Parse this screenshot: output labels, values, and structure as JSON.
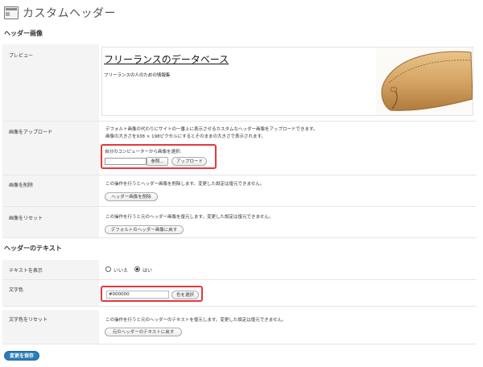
{
  "page": {
    "title": "カスタムヘッダー"
  },
  "sections": {
    "header_image": "ヘッダー画像",
    "header_text": "ヘッダーのテキスト"
  },
  "preview": {
    "label": "プレビュー",
    "site_title": "フリーランスのデータベース",
    "site_tagline": "フリーランスの人のための情報集"
  },
  "upload": {
    "label": "画像をアップロード",
    "desc_line1": "デフォルト画像の代わりにサイトの一番上に表示させるカスタムなヘッダー画像をアップロードできます。",
    "desc_line2": "画像の大きさを938 × 198ピクセルにするとそのままの大きさで表示されます。",
    "choose_label": "自分のコンピューターから画像を選択:",
    "browse_button": "参照...",
    "upload_button": "アップロード"
  },
  "remove": {
    "label": "画像を削除",
    "desc": "この操作を行うとヘッダー画像を削除します。変更した設定は復元できません。",
    "button": "ヘッダー画像を削除"
  },
  "reset": {
    "label": "画像をリセット",
    "desc": "この操作を行うと元のヘッダー画像を復元します。変更した設定は復元できません。",
    "button": "デフォルトのヘッダー画像に戻す"
  },
  "show_text": {
    "label": "テキストを表示",
    "option_no": "いいえ",
    "option_yes": "はい",
    "selected": "はい"
  },
  "text_color": {
    "label": "文字色",
    "value": "#000000",
    "button": "色を選択"
  },
  "reset_color": {
    "label": "文字色をリセット",
    "desc": "この操作を行うと元のヘッダーのテキストを復元します。変更した設定は復元できません。",
    "button": "元のヘッダーのテキストに戻す"
  },
  "save_button": "変更を保存",
  "colors": {
    "highlight": "#e23a3a",
    "primary_button": "#2a7db8",
    "row_bg": "#f4f4f4"
  }
}
